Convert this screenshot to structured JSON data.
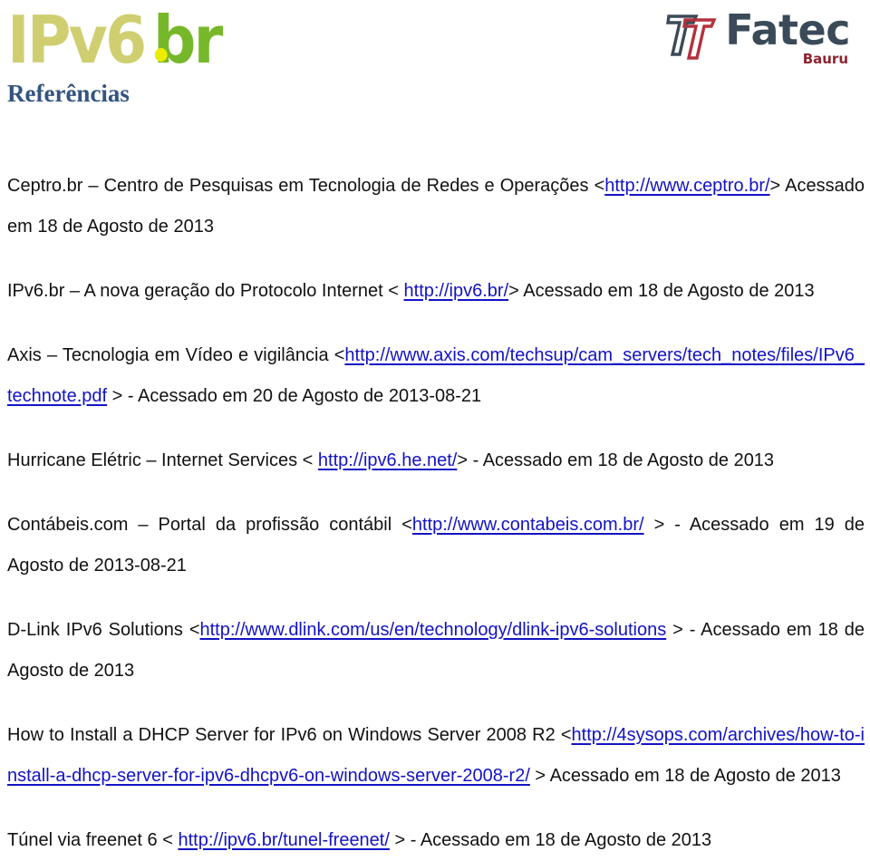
{
  "header": {
    "ipv6_logo": {
      "name": "ipv6-br-logo",
      "part_main": "IPv6",
      "part_tld": "br",
      "color_main": "#cfcf71",
      "color_tld": "#76b82a",
      "color_dot": "#ecec00"
    },
    "fatec_logo": {
      "name": "fatec-bauru-logo",
      "word": "Fatec",
      "sub": "Bauru",
      "color_word": "#3a4a58",
      "color_sub": "#8f2330",
      "color_mark_blue": "#3a4a58",
      "color_mark_red": "#b3313c"
    }
  },
  "title": "Referências",
  "title_color": "#335480",
  "link_color": "#1313c4",
  "references": [
    {
      "id": "ceptro",
      "segments": [
        {
          "text": "Ceptro.br – Centro de Pesquisas em Tecnologia de Redes e Operações <",
          "link": false
        },
        {
          "text": "http://www.ceptro.br/",
          "link": true
        },
        {
          "text": "> Acessado em 18 de Agosto de 2013",
          "link": false
        }
      ]
    },
    {
      "id": "ipv6br",
      "segments": [
        {
          "text": "IPv6.br – A nova geração do Protocolo Internet < ",
          "link": false
        },
        {
          "text": "http://ipv6.br/",
          "link": true
        },
        {
          "text": "> Acessado em 18 de Agosto de 2013",
          "link": false
        }
      ]
    },
    {
      "id": "axis",
      "segments": [
        {
          "text": "Axis – Tecnologia em Vídeo e vigilância <",
          "link": false
        },
        {
          "text": "http://www.axis.com/techsup/cam_servers/tech_notes/files/IPv6_technote.pdf",
          "link": true
        },
        {
          "text": " > - Acessado em 20 de Agosto de 2013-08-21",
          "link": false
        }
      ]
    },
    {
      "id": "hurricane",
      "segments": [
        {
          "text": "Hurricane Elétric – Internet Services < ",
          "link": false
        },
        {
          "text": "http://ipv6.he.net/",
          "link": true
        },
        {
          "text": "> - Acessado em 18 de Agosto de 2013",
          "link": false
        }
      ]
    },
    {
      "id": "contabeis",
      "segments": [
        {
          "text": "Contábeis.com – Portal da profissão contábil <",
          "link": false
        },
        {
          "text": "http://www.contabeis.com.br/",
          "link": true
        },
        {
          "text": " > - Acessado em 19 de Agosto de 2013-08-21",
          "link": false
        }
      ]
    },
    {
      "id": "dlink",
      "segments": [
        {
          "text": "D-Link IPv6 Solutions <",
          "link": false
        },
        {
          "text": "http://www.dlink.com/us/en/technology/dlink-ipv6-solutions",
          "link": true
        },
        {
          "text": " > - Acessado em 18 de Agosto de 2013",
          "link": false
        }
      ]
    },
    {
      "id": "4sysops",
      "segments": [
        {
          "text": "How to Install a DHCP Server for IPv6 on Windows Server 2008 R2 <",
          "link": false
        },
        {
          "text": "http://4sysops.com/archives/how-to-install-a-dhcp-server-for-ipv6-dhcpv6-on-windows-server-2008-r2/",
          "link": true
        },
        {
          "text": " > Acessado em 18 de Agosto de 2013",
          "link": false
        }
      ]
    },
    {
      "id": "tunel-freenet",
      "segments": [
        {
          "text": "Túnel via freenet 6 < ",
          "link": false
        },
        {
          "text": "http://ipv6.br/tunel-freenet/",
          "link": true
        },
        {
          "text": " > - Acessado em 18 de Agosto de 2013",
          "link": false
        }
      ]
    }
  ]
}
